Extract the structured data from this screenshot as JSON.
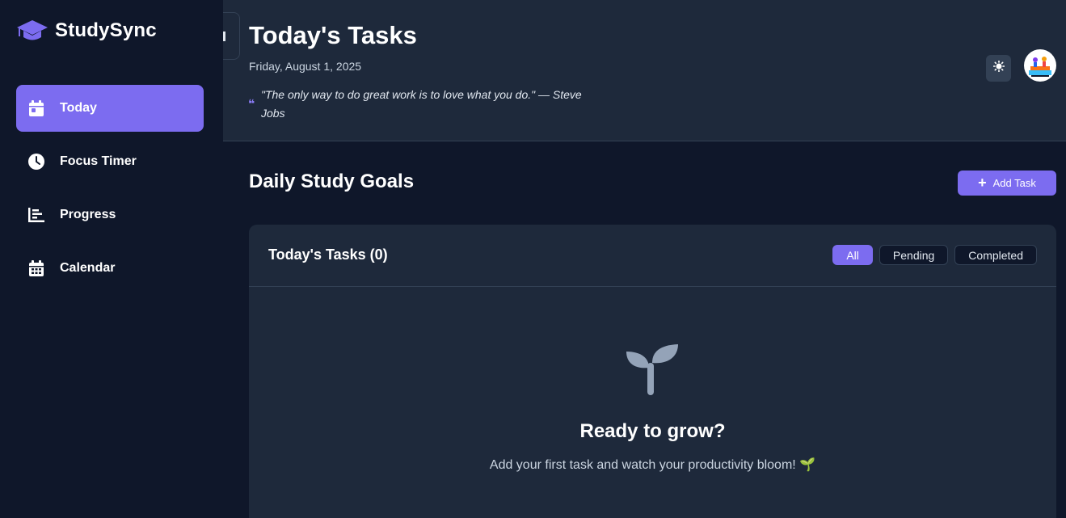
{
  "brand": {
    "name": "StudySync",
    "icon": "graduation-cap-icon"
  },
  "sidebar": {
    "items": [
      {
        "label": "Today",
        "icon": "calendar-day-icon",
        "active": true
      },
      {
        "label": "Focus Timer",
        "icon": "clock-icon",
        "active": false
      },
      {
        "label": "Progress",
        "icon": "bar-chart-icon",
        "active": false
      },
      {
        "label": "Calendar",
        "icon": "calendar-icon",
        "active": false
      }
    ]
  },
  "header": {
    "title": "Today's Tasks",
    "date": "Friday, August 1, 2025",
    "quote": "\"The only way to do great work is to love what you do.\" — Steve Jobs",
    "theme_icon": "sun-icon",
    "avatar_icon": "user-avatar-icon"
  },
  "main": {
    "section_title": "Daily Study Goals",
    "add_task_label": "Add Task",
    "card": {
      "title": "Today's Tasks (0)",
      "filters": [
        {
          "label": "All",
          "active": true
        },
        {
          "label": "Pending",
          "active": false
        },
        {
          "label": "Completed",
          "active": false
        }
      ],
      "empty_title": "Ready to grow?",
      "empty_text": "Add your first task and watch your productivity bloom! 🌱"
    }
  },
  "colors": {
    "accent": "#7c6cf0",
    "sidebar_bg": "#0f172a",
    "panel_bg": "#1e293b",
    "page_bg": "#0f172a"
  }
}
